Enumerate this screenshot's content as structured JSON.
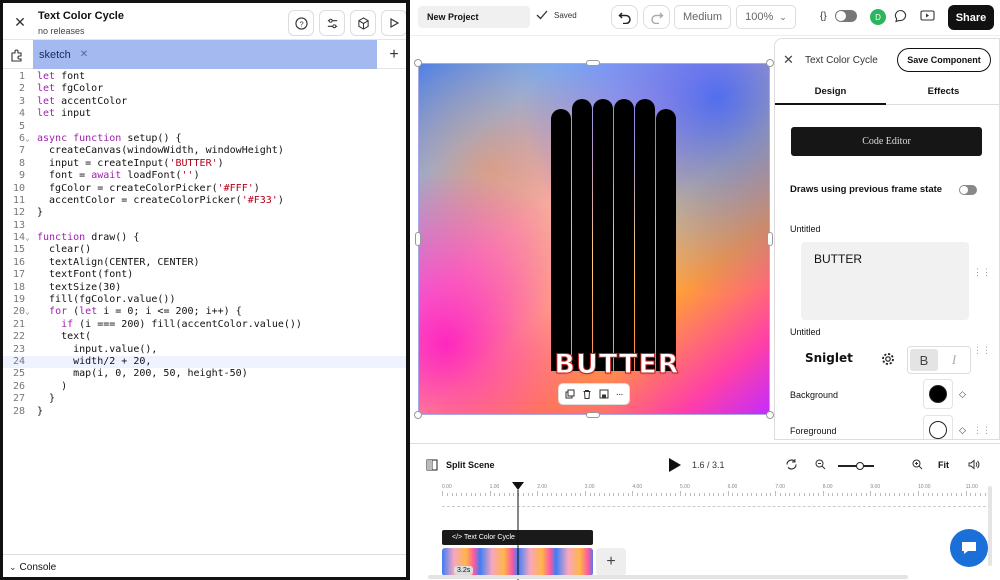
{
  "editor": {
    "title": "Text Color Cycle",
    "subtitle": "no releases",
    "tab_label": "sketch",
    "console_label": "Console",
    "lines": [
      {
        "n": "1",
        "tokens": [
          {
            "t": "let",
            "c": "kw"
          },
          {
            "t": " font",
            "c": ""
          }
        ]
      },
      {
        "n": "2",
        "tokens": [
          {
            "t": "let",
            "c": "kw"
          },
          {
            "t": " fgColor",
            "c": ""
          }
        ]
      },
      {
        "n": "3",
        "tokens": [
          {
            "t": "let",
            "c": "kw"
          },
          {
            "t": " accentColor",
            "c": ""
          }
        ]
      },
      {
        "n": "4",
        "tokens": [
          {
            "t": "let",
            "c": "kw"
          },
          {
            "t": " input",
            "c": ""
          }
        ]
      },
      {
        "n": "5",
        "tokens": []
      },
      {
        "n": "6",
        "fold": true,
        "tokens": [
          {
            "t": "async function",
            "c": "kw"
          },
          {
            "t": " setup() {",
            "c": ""
          }
        ]
      },
      {
        "n": "7",
        "tokens": [
          {
            "t": "  createCanvas(windowWidth, windowHeight)",
            "c": ""
          }
        ]
      },
      {
        "n": "8",
        "tokens": [
          {
            "t": "  input = createInput(",
            "c": ""
          },
          {
            "t": "'BUTTER'",
            "c": "str"
          },
          {
            "t": ")",
            "c": ""
          }
        ]
      },
      {
        "n": "9",
        "tokens": [
          {
            "t": "  font = ",
            "c": ""
          },
          {
            "t": "await",
            "c": "kw"
          },
          {
            "t": " loadFont(",
            "c": ""
          },
          {
            "t": "''",
            "c": "str"
          },
          {
            "t": ")",
            "c": ""
          }
        ]
      },
      {
        "n": "10",
        "tokens": [
          {
            "t": "  fgColor = createColorPicker(",
            "c": ""
          },
          {
            "t": "'#FFF'",
            "c": "str"
          },
          {
            "t": ")",
            "c": ""
          }
        ]
      },
      {
        "n": "11",
        "tokens": [
          {
            "t": "  accentColor = createColorPicker(",
            "c": ""
          },
          {
            "t": "'#F33'",
            "c": "str"
          },
          {
            "t": ")",
            "c": ""
          }
        ]
      },
      {
        "n": "12",
        "tokens": [
          {
            "t": "}",
            "c": ""
          }
        ]
      },
      {
        "n": "13",
        "tokens": []
      },
      {
        "n": "14",
        "fold": true,
        "tokens": [
          {
            "t": "function",
            "c": "kw"
          },
          {
            "t": " draw() {",
            "c": ""
          }
        ]
      },
      {
        "n": "15",
        "tokens": [
          {
            "t": "  clear()",
            "c": ""
          }
        ]
      },
      {
        "n": "16",
        "tokens": [
          {
            "t": "  textAlign(CENTER, CENTER)",
            "c": ""
          }
        ]
      },
      {
        "n": "17",
        "tokens": [
          {
            "t": "  textFont(font)",
            "c": ""
          }
        ]
      },
      {
        "n": "18",
        "tokens": [
          {
            "t": "  textSize(30)",
            "c": ""
          }
        ]
      },
      {
        "n": "19",
        "tokens": [
          {
            "t": "  fill(fgColor.value())",
            "c": ""
          }
        ]
      },
      {
        "n": "20",
        "fold": true,
        "tokens": [
          {
            "t": "  ",
            "c": ""
          },
          {
            "t": "for",
            "c": "kw"
          },
          {
            "t": " (",
            "c": ""
          },
          {
            "t": "let",
            "c": "kw"
          },
          {
            "t": " i = 0; i <= 200; i++) {",
            "c": ""
          }
        ]
      },
      {
        "n": "21",
        "tokens": [
          {
            "t": "    ",
            "c": ""
          },
          {
            "t": "if",
            "c": "kw"
          },
          {
            "t": " (i === 200) fill(accentColor.value())",
            "c": ""
          }
        ]
      },
      {
        "n": "22",
        "tokens": [
          {
            "t": "    text(",
            "c": ""
          }
        ]
      },
      {
        "n": "23",
        "tokens": [
          {
            "t": "      input.value(),",
            "c": ""
          }
        ]
      },
      {
        "n": "24",
        "active": true,
        "tokens": [
          {
            "t": "      width/2 + 20,",
            "c": ""
          }
        ]
      },
      {
        "n": "25",
        "tokens": [
          {
            "t": "      map(i, 0, 200, 50, height-50)",
            "c": ""
          }
        ]
      },
      {
        "n": "26",
        "tokens": [
          {
            "t": "    )",
            "c": ""
          }
        ]
      },
      {
        "n": "27",
        "tokens": [
          {
            "t": "  }",
            "c": ""
          }
        ]
      },
      {
        "n": "28",
        "tokens": [
          {
            "t": "}",
            "c": ""
          }
        ]
      }
    ]
  },
  "toolbar": {
    "project_name": "New Project",
    "saved_label": "Saved",
    "quality": "Medium",
    "zoom": "100%",
    "code_icon_text": "{}",
    "avatar_letter": "D",
    "share_label": "Share"
  },
  "canvas": {
    "word": "BUTTER",
    "stripe_count": 6
  },
  "panel": {
    "title": "Text Color Cycle",
    "save_label": "Save Component",
    "tab_design": "Design",
    "tab_effects": "Effects",
    "code_editor_label": "Code Editor",
    "prev_frame_label": "Draws using previous frame state",
    "untitled1": "Untitled",
    "text_value": "BUTTER",
    "untitled2": "Untitled",
    "font_name": "Sniglet",
    "bold_label": "B",
    "italic_label": "I",
    "background_label": "Background",
    "foreground_label": "Foreground",
    "background_color": "#000000",
    "foreground_color": "#ffffff"
  },
  "timeline": {
    "split_label": "Split Scene",
    "time_display": "1.6 / 3.1",
    "fit_label": "Fit",
    "ticks": [
      "0.00",
      "1.00",
      "2.00",
      "3.00",
      "4.00",
      "5.00",
      "6.00",
      "7.00",
      "8.00",
      "9.00",
      "10.00",
      "11.00"
    ],
    "clip_label": "</> Text Color Cycle",
    "clip_duration": "3.2s",
    "playhead_time": 1.6,
    "zoom_level": 0.6
  }
}
